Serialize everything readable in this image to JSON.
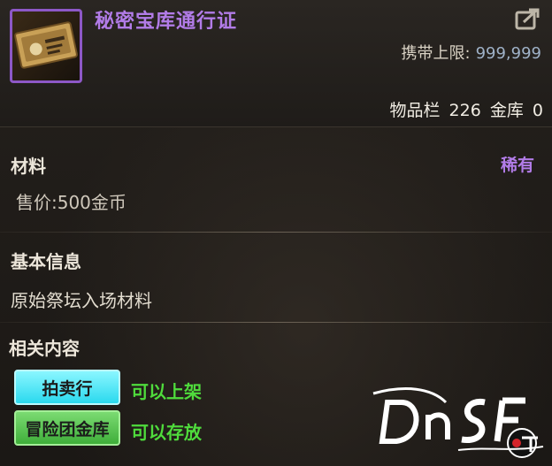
{
  "item": {
    "name": "秘密宝库通行证",
    "rarity_color": "#b27ce8"
  },
  "header": {
    "carry_limit_label": "携带上限:",
    "carry_limit_value": "999,999",
    "inventory_label": "物品栏",
    "inventory_count": "226",
    "bank_label": "金库",
    "bank_count": "0"
  },
  "material": {
    "title": "材料",
    "rarity": "稀有",
    "price": "售价:500金币"
  },
  "basic_info": {
    "title": "基本信息",
    "description": "原始祭坛入场材料"
  },
  "related": {
    "title": "相关内容",
    "auction_button": "拍卖行",
    "auction_status": "可以上架",
    "bank_button": "冒险团金库",
    "bank_status": "可以存放"
  },
  "icons": [
    "vault-pass-item-icon",
    "share-icon",
    "watermark-logo"
  ],
  "colors": {
    "rare_purple": "#b27ce8",
    "status_green": "#4fdc3c",
    "auction_cyan": "#2ad9ee",
    "bank_green": "#3fae3a"
  }
}
